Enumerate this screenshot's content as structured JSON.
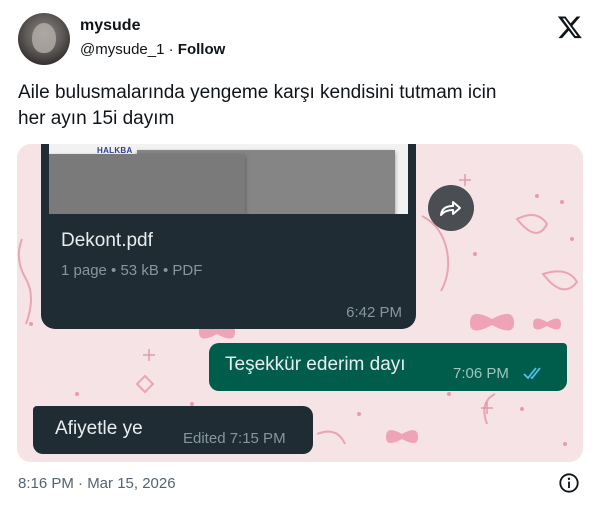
{
  "author": {
    "name": "mysude",
    "handle": "@mysude_1",
    "separator": "·",
    "follow_label": "Follow"
  },
  "tweet": {
    "text_line1": "Aile bulusmalarında yengeme karşı kendisini tutmam icin",
    "text_line2": "her ayın 15i dayım",
    "timestamp": "8:16 PM · Mar 15, 2026"
  },
  "chat": {
    "document": {
      "bank_logo_text": "HALKBA",
      "file_name": "Dekont.pdf",
      "meta": "1 page • 53 kB • PDF",
      "time": "6:42 PM"
    },
    "outgoing_message": {
      "text": "Teşekkür ederim dayı",
      "time": "7:06 PM",
      "status": "read"
    },
    "incoming_message": {
      "text": "Afiyetle ye",
      "time": "Edited 7:15 PM"
    }
  },
  "colors": {
    "chat_background": "#f5e1e4",
    "incoming_bubble": "#1f2c34",
    "outgoing_bubble": "#005c4b",
    "read_ticks": "#53bdeb"
  },
  "icons": {
    "brand": "x-logo-icon",
    "forward": "forward-icon",
    "read_status": "double-check-icon",
    "info": "info-icon"
  }
}
